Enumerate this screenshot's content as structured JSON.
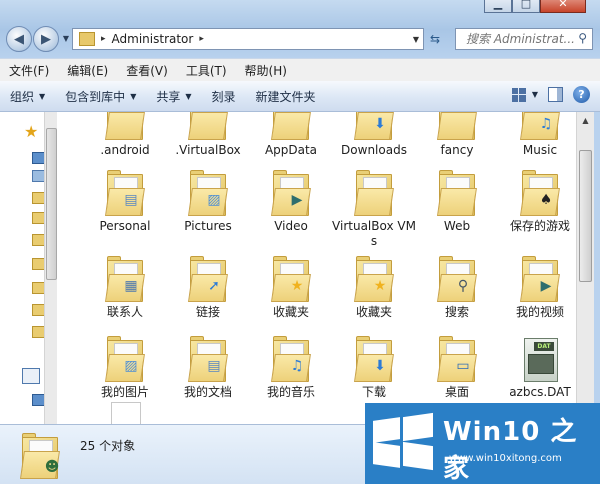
{
  "window": {
    "caption_buttons": [
      "minimize",
      "maximize",
      "close"
    ]
  },
  "address": {
    "crumb": "Administrator",
    "separator": "▸"
  },
  "search": {
    "placeholder": "搜索 Administrat..."
  },
  "menu": [
    "文件(F)",
    "编辑(E)",
    "查看(V)",
    "工具(T)",
    "帮助(H)"
  ],
  "toolbar": {
    "organize": "组织",
    "include_library": "包含到库中",
    "share": "共享",
    "burn": "刻录",
    "new_folder": "新建文件夹"
  },
  "items": [
    {
      "label": ".android",
      "type": "folder",
      "badge": ""
    },
    {
      "label": ".VirtualBox",
      "type": "folder",
      "badge": ""
    },
    {
      "label": "AppData",
      "type": "folder",
      "badge": ""
    },
    {
      "label": "Downloads",
      "type": "folder",
      "badge": "download-arrow"
    },
    {
      "label": "fancy",
      "type": "folder",
      "badge": ""
    },
    {
      "label": "Music",
      "type": "folder",
      "badge": "music-note"
    },
    {
      "label": "Personal",
      "type": "folder",
      "badge": "document"
    },
    {
      "label": "Pictures",
      "type": "folder",
      "badge": "picture"
    },
    {
      "label": "Video",
      "type": "folder",
      "badge": "film"
    },
    {
      "label": "VirtualBox VMs",
      "type": "folder",
      "badge": ""
    },
    {
      "label": "Web",
      "type": "folder",
      "badge": ""
    },
    {
      "label": "保存的游戏",
      "type": "folder",
      "badge": "spade"
    },
    {
      "label": "联系人",
      "type": "folder",
      "badge": "contact-card"
    },
    {
      "label": "链接",
      "type": "folder",
      "badge": "link-arrow"
    },
    {
      "label": "收藏夹",
      "type": "folder",
      "badge": "star"
    },
    {
      "label": "收藏夹",
      "type": "folder",
      "badge": "star"
    },
    {
      "label": "搜索",
      "type": "folder",
      "badge": "magnifier"
    },
    {
      "label": "我的视频",
      "type": "folder",
      "badge": "film"
    },
    {
      "label": "我的图片",
      "type": "folder",
      "badge": "picture"
    },
    {
      "label": "我的文档",
      "type": "folder",
      "badge": "document"
    },
    {
      "label": "我的音乐",
      "type": "folder",
      "badge": "music-note"
    },
    {
      "label": "下载",
      "type": "folder",
      "badge": "download-arrow"
    },
    {
      "label": "桌面",
      "type": "folder",
      "badge": "desktop"
    },
    {
      "label": "azbcs.DAT",
      "type": "dat",
      "badge": "DAT"
    },
    {
      "label": "",
      "type": "blank",
      "badge": ""
    }
  ],
  "status": {
    "count": "25 个对象"
  },
  "watermark": {
    "brand": "Win10 之家",
    "url": "www.win10xitong.com"
  },
  "colors": {
    "accent": "#2a7fc6",
    "folder": "#edd17a",
    "toolbar_top": "#f6f9fd",
    "toolbar_bottom": "#cfdcef"
  }
}
